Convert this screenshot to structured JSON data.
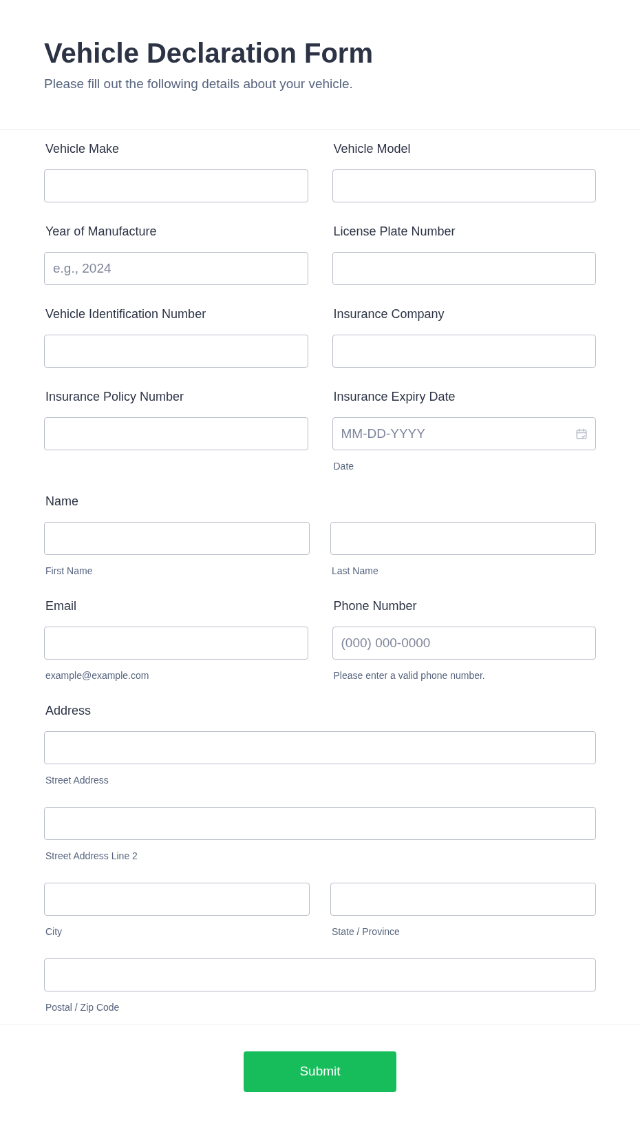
{
  "header": {
    "title": "Vehicle Declaration Form",
    "subtitle": "Please fill out the following details about your vehicle."
  },
  "fields": [
    {
      "kind": "text",
      "label": "Vehicle Make"
    },
    {
      "kind": "text",
      "label": "Vehicle Model"
    },
    {
      "kind": "text",
      "label": "Year of Manufacture",
      "placeholder": "e.g., 2024"
    },
    {
      "kind": "text",
      "label": "License Plate Number"
    },
    {
      "kind": "text",
      "label": "Vehicle Identification Number"
    },
    {
      "kind": "text",
      "label": "Insurance Company"
    },
    {
      "kind": "text",
      "label": "Insurance Policy Number"
    },
    {
      "kind": "date",
      "label": "Insurance Expiry Date",
      "placeholder": "MM-DD-YYYY",
      "sublabel": "Date"
    },
    {
      "kind": "group",
      "label": "Name",
      "rows": [
        [
          {
            "sublabel": "First Name"
          },
          {
            "sublabel": "Last Name"
          }
        ]
      ]
    },
    {
      "kind": "text",
      "label": "Email",
      "sublabel": "example@example.com"
    },
    {
      "kind": "text",
      "label": "Phone Number",
      "placeholder": "(000) 000-0000",
      "sublabel": "Please enter a valid phone number."
    },
    {
      "kind": "group",
      "label": "Address",
      "rows": [
        [
          {
            "sublabel": "Street Address"
          }
        ],
        [
          {
            "sublabel": "Street Address Line 2"
          }
        ],
        [
          {
            "sublabel": "City"
          },
          {
            "sublabel": "State / Province"
          }
        ],
        [
          {
            "sublabel": "Postal / Zip Code"
          }
        ]
      ]
    }
  ],
  "submit": "Submit"
}
